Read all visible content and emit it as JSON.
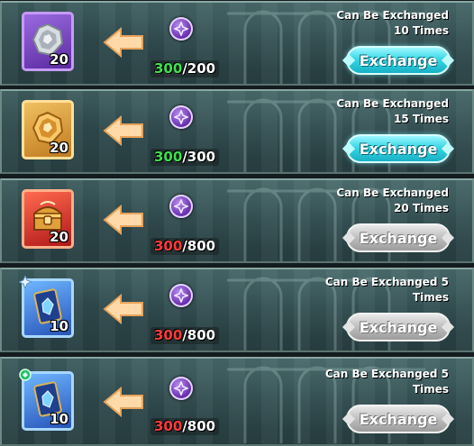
{
  "currency": {
    "icon": "purple-token-icon"
  },
  "rows": [
    {
      "item": {
        "icon": "silver-badge-icon",
        "count": "20"
      },
      "cost": {
        "have": "300",
        "sep": "/",
        "need": "200",
        "enough": true
      },
      "limit_text": "Can Be Exchanged\n10 Times",
      "button": {
        "label": "Exchange",
        "enabled": true
      }
    },
    {
      "item": {
        "icon": "gold-badge-icon",
        "count": "20"
      },
      "cost": {
        "have": "300",
        "sep": "/",
        "need": "300",
        "enough": true
      },
      "limit_text": "Can Be Exchanged\n15 Times",
      "button": {
        "label": "Exchange",
        "enabled": true
      }
    },
    {
      "item": {
        "icon": "treasure-chest-icon",
        "count": "20"
      },
      "cost": {
        "have": "300",
        "sep": "/",
        "need": "800",
        "enough": false
      },
      "limit_text": "Can Be Exchanged\n20 Times",
      "button": {
        "label": "Exchange",
        "enabled": false
      }
    },
    {
      "item": {
        "icon": "blue-card-icon",
        "count": "10"
      },
      "cost": {
        "have": "300",
        "sep": "/",
        "need": "800",
        "enough": false
      },
      "limit_text": "Can Be Exchanged 5\nTimes",
      "button": {
        "label": "Exchange",
        "enabled": false
      }
    },
    {
      "item": {
        "icon": "blue-card-icon",
        "count": "10"
      },
      "cost": {
        "have": "300",
        "sep": "/",
        "need": "800",
        "enough": false
      },
      "limit_text": "Can Be Exchanged 5\nTimes",
      "button": {
        "label": "Exchange",
        "enabled": false
      }
    }
  ]
}
